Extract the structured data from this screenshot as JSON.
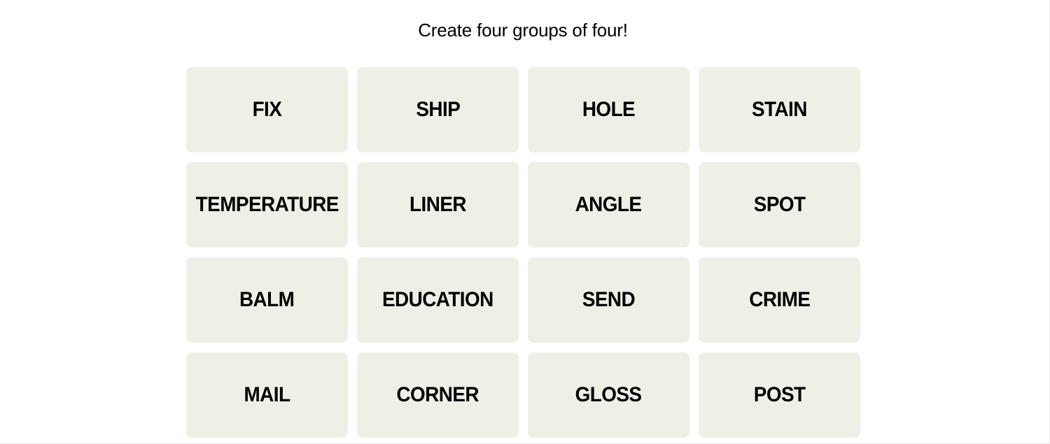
{
  "game": {
    "subtitle": "Create four groups of four!",
    "tile_background": "#EFEFE6",
    "tile_text_color": "#000000",
    "tiles": [
      {
        "word": "FIX"
      },
      {
        "word": "SHIP"
      },
      {
        "word": "HOLE"
      },
      {
        "word": "STAIN"
      },
      {
        "word": "TEMPERATURE"
      },
      {
        "word": "LINER"
      },
      {
        "word": "ANGLE"
      },
      {
        "word": "SPOT"
      },
      {
        "word": "BALM"
      },
      {
        "word": "EDUCATION"
      },
      {
        "word": "SEND"
      },
      {
        "word": "CRIME"
      },
      {
        "word": "MAIL"
      },
      {
        "word": "CORNER"
      },
      {
        "word": "GLOSS"
      },
      {
        "word": "POST"
      }
    ]
  }
}
